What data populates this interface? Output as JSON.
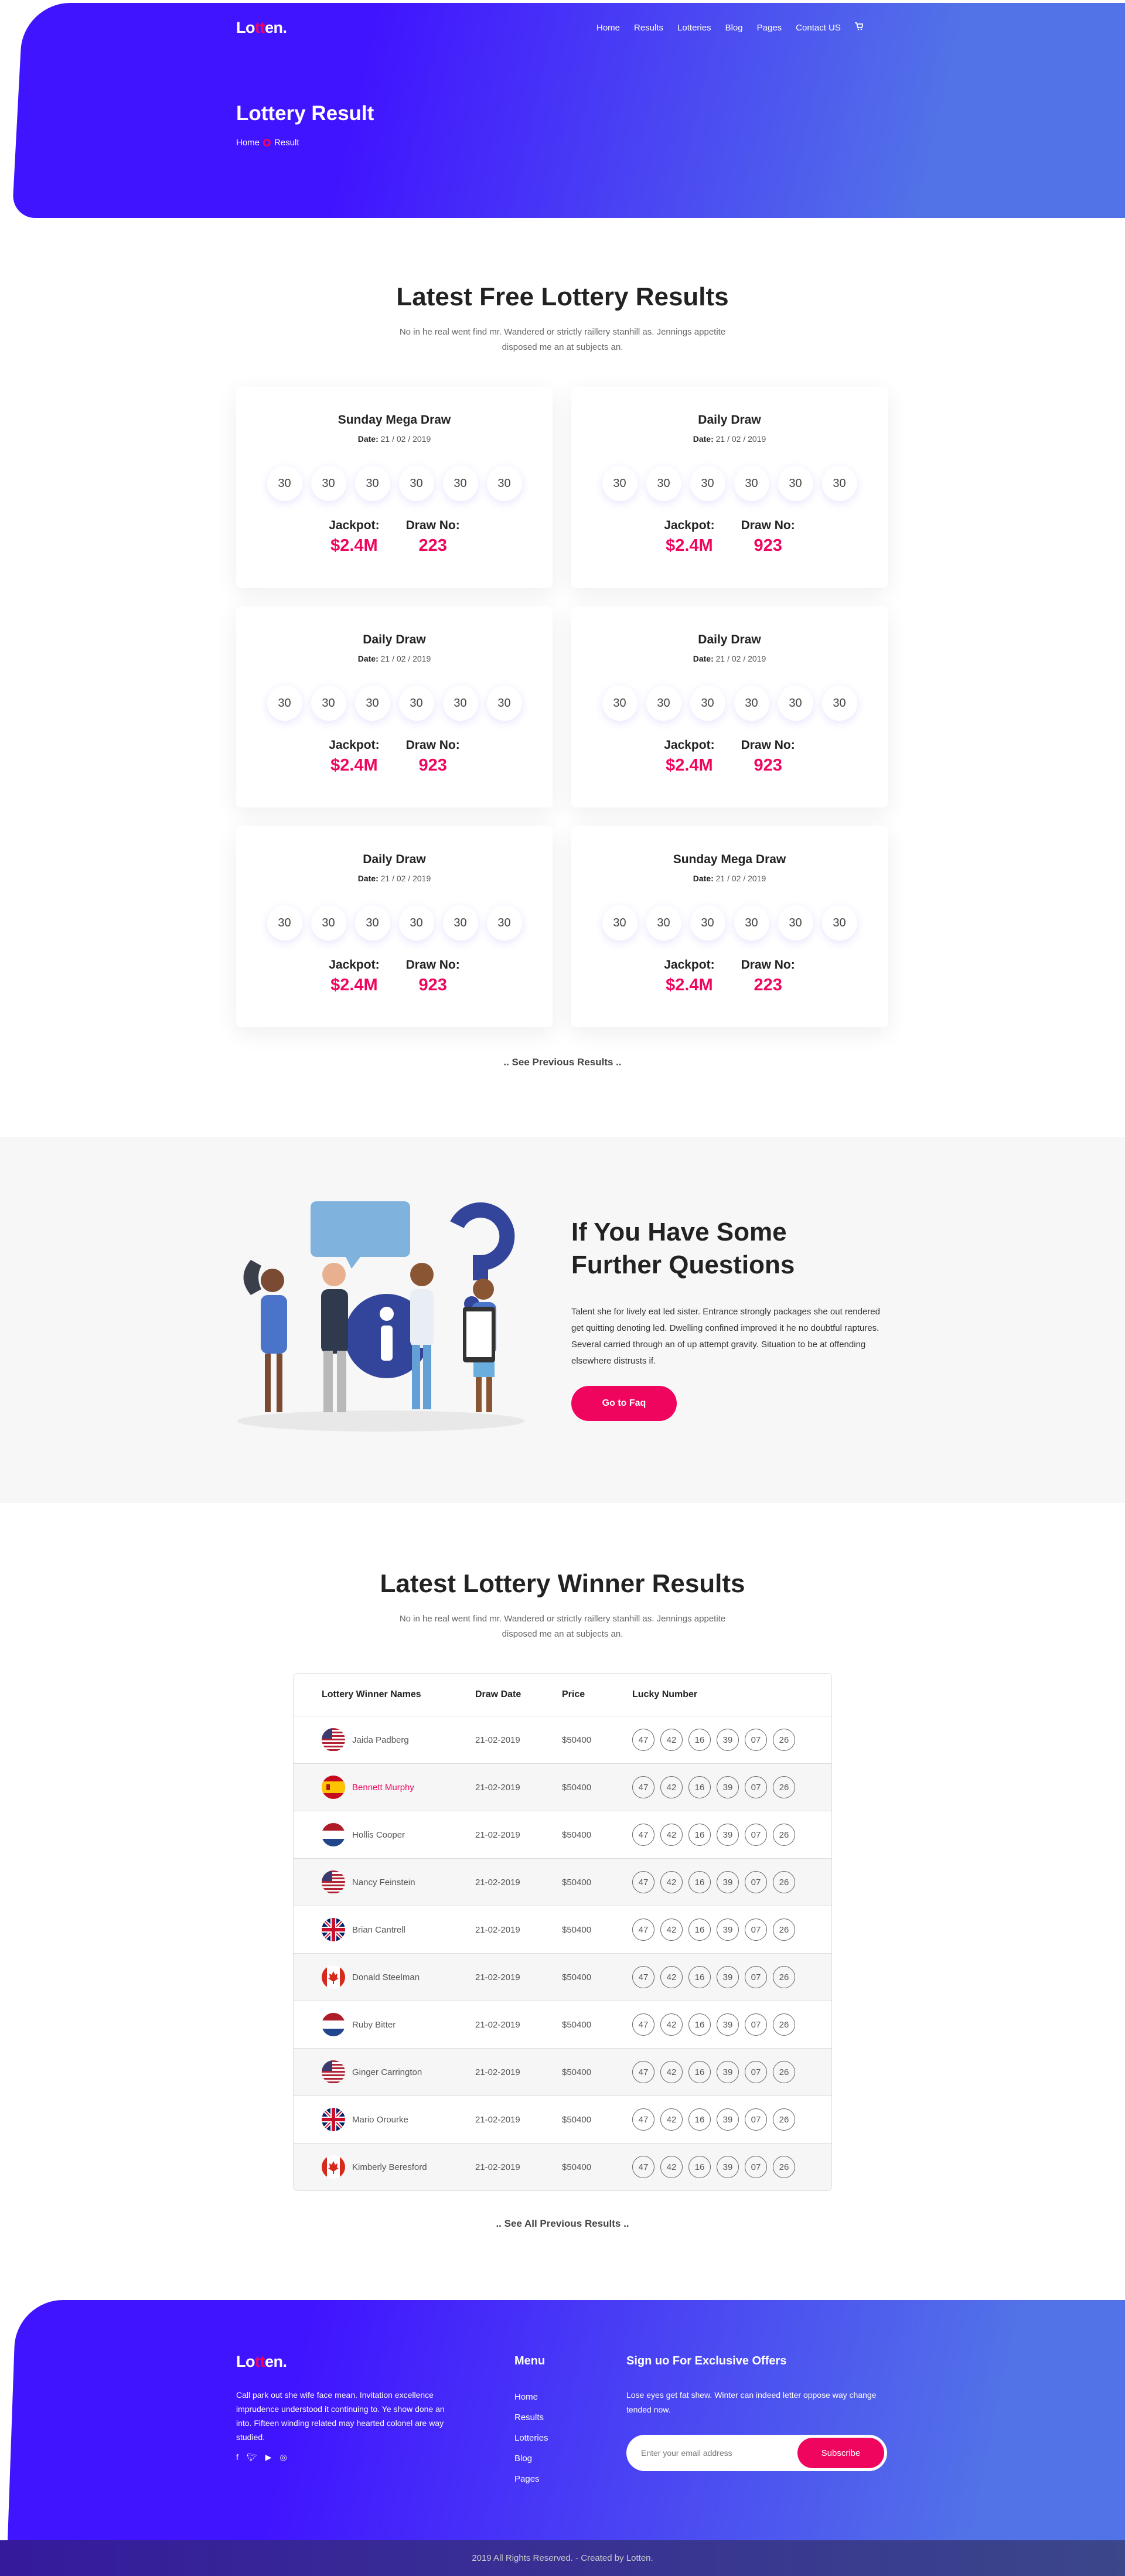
{
  "header": {
    "logo": {
      "pre": "Lo",
      "mid": "tt",
      "post": "en."
    },
    "nav": [
      "Home",
      "Results",
      "Lotteries",
      "Blog",
      "Pages",
      "Contact US"
    ],
    "page_title": "Lottery Result",
    "breadcrumb": [
      "Home",
      "Result"
    ]
  },
  "results": {
    "title": "Latest Free Lottery Results",
    "subtitle": "No in he real went find mr. Wandered or strictly raillery stanhill as. Jennings appetite disposed me an at subjects an.",
    "date_label": "Date:",
    "jackpot_label": "Jackpot:",
    "drawno_label": "Draw No:",
    "cards": [
      {
        "name": "Sunday Mega Draw",
        "date": "21 / 02 / 2019",
        "numbers": [
          "30",
          "30",
          "30",
          "30",
          "30",
          "30"
        ],
        "jackpot": "$2.4M",
        "draw_no": "223"
      },
      {
        "name": "Daily Draw",
        "date": "21 / 02 / 2019",
        "numbers": [
          "30",
          "30",
          "30",
          "30",
          "30",
          "30"
        ],
        "jackpot": "$2.4M",
        "draw_no": "923"
      },
      {
        "name": "Daily Draw",
        "date": "21 / 02 / 2019",
        "numbers": [
          "30",
          "30",
          "30",
          "30",
          "30",
          "30"
        ],
        "jackpot": "$2.4M",
        "draw_no": "923"
      },
      {
        "name": "Daily Draw",
        "date": "21 / 02 / 2019",
        "numbers": [
          "30",
          "30",
          "30",
          "30",
          "30",
          "30"
        ],
        "jackpot": "$2.4M",
        "draw_no": "923"
      },
      {
        "name": "Daily Draw",
        "date": "21 / 02 / 2019",
        "numbers": [
          "30",
          "30",
          "30",
          "30",
          "30",
          "30"
        ],
        "jackpot": "$2.4M",
        "draw_no": "923"
      },
      {
        "name": "Sunday Mega Draw",
        "date": "21 / 02 / 2019",
        "numbers": [
          "30",
          "30",
          "30",
          "30",
          "30",
          "30"
        ],
        "jackpot": "$2.4M",
        "draw_no": "223"
      }
    ],
    "more": ".. See Previous Results .."
  },
  "faq": {
    "title_line1": "If You Have Some",
    "title_line2": "Further Questions",
    "text": "Talent she for lively eat led sister. Entrance strongly packages she out rendered get quitting denoting led. Dwelling confined improved it he no doubtful raptures. Several carried through an of up attempt gravity. Situation to be at offending elsewhere distrusts if.",
    "button": "Go to Faq"
  },
  "winners": {
    "title": "Latest Lottery Winner Results",
    "subtitle": "No in he real went find mr. Wandered or strictly raillery stanhill as. Jennings appetite disposed me an at subjects an.",
    "columns": [
      "Lottery Winner Names",
      "Draw Date",
      "Price",
      "Lucky Number"
    ],
    "rows": [
      {
        "flag": "us",
        "name": "Jaida Padberg",
        "date": "21-02-2019",
        "price": "$50400",
        "numbers": [
          "47",
          "42",
          "16",
          "39",
          "07",
          "26"
        ]
      },
      {
        "flag": "es",
        "name": "Bennett Murphy",
        "date": "21-02-2019",
        "price": "$50400",
        "numbers": [
          "47",
          "42",
          "16",
          "39",
          "07",
          "26"
        ],
        "highlight": true
      },
      {
        "flag": "nl",
        "name": "Hollis Cooper",
        "date": "21-02-2019",
        "price": "$50400",
        "numbers": [
          "47",
          "42",
          "16",
          "39",
          "07",
          "26"
        ]
      },
      {
        "flag": "us",
        "name": "Nancy Feinstein",
        "date": "21-02-2019",
        "price": "$50400",
        "numbers": [
          "47",
          "42",
          "16",
          "39",
          "07",
          "26"
        ]
      },
      {
        "flag": "uk",
        "name": "Brian Cantrell",
        "date": "21-02-2019",
        "price": "$50400",
        "numbers": [
          "47",
          "42",
          "16",
          "39",
          "07",
          "26"
        ]
      },
      {
        "flag": "ca",
        "name": "Donald Steelman",
        "date": "21-02-2019",
        "price": "$50400",
        "numbers": [
          "47",
          "42",
          "16",
          "39",
          "07",
          "26"
        ]
      },
      {
        "flag": "nl",
        "name": "Ruby Bitter",
        "date": "21-02-2019",
        "price": "$50400",
        "numbers": [
          "47",
          "42",
          "16",
          "39",
          "07",
          "26"
        ]
      },
      {
        "flag": "us",
        "name": "Ginger Carrington",
        "date": "21-02-2019",
        "price": "$50400",
        "numbers": [
          "47",
          "42",
          "16",
          "39",
          "07",
          "26"
        ]
      },
      {
        "flag": "uk",
        "name": "Mario Orourke",
        "date": "21-02-2019",
        "price": "$50400",
        "numbers": [
          "47",
          "42",
          "16",
          "39",
          "07",
          "26"
        ]
      },
      {
        "flag": "ca",
        "name": "Kimberly Beresford",
        "date": "21-02-2019",
        "price": "$50400",
        "numbers": [
          "47",
          "42",
          "16",
          "39",
          "07",
          "26"
        ]
      }
    ],
    "more": ".. See All Previous Results .."
  },
  "footer": {
    "about": "Call park out she wife face mean. Invitation excellence imprudence understood it continuing to. Ye show done an into. Fifteen winding related may hearted colonel are way studied.",
    "social": [
      "facebook-icon",
      "twitter-icon",
      "youtube-icon",
      "dribbble-icon"
    ],
    "menu_title": "Menu",
    "menu": [
      "Home",
      "Results",
      "Lotteries",
      "Blog",
      "Pages"
    ],
    "signup_title": "Sign uo For Exclusive Offers",
    "signup_text": "Lose eyes get fat shew. Winter can indeed letter oppose way change tended now.",
    "email_placeholder": "Enter your email address",
    "subscribe": "Subscribe",
    "copyright": "2019 All Rights Reserved. - Created by Lotten."
  },
  "colors": {
    "primary": "#4114ff",
    "accent": "#f0055e"
  }
}
